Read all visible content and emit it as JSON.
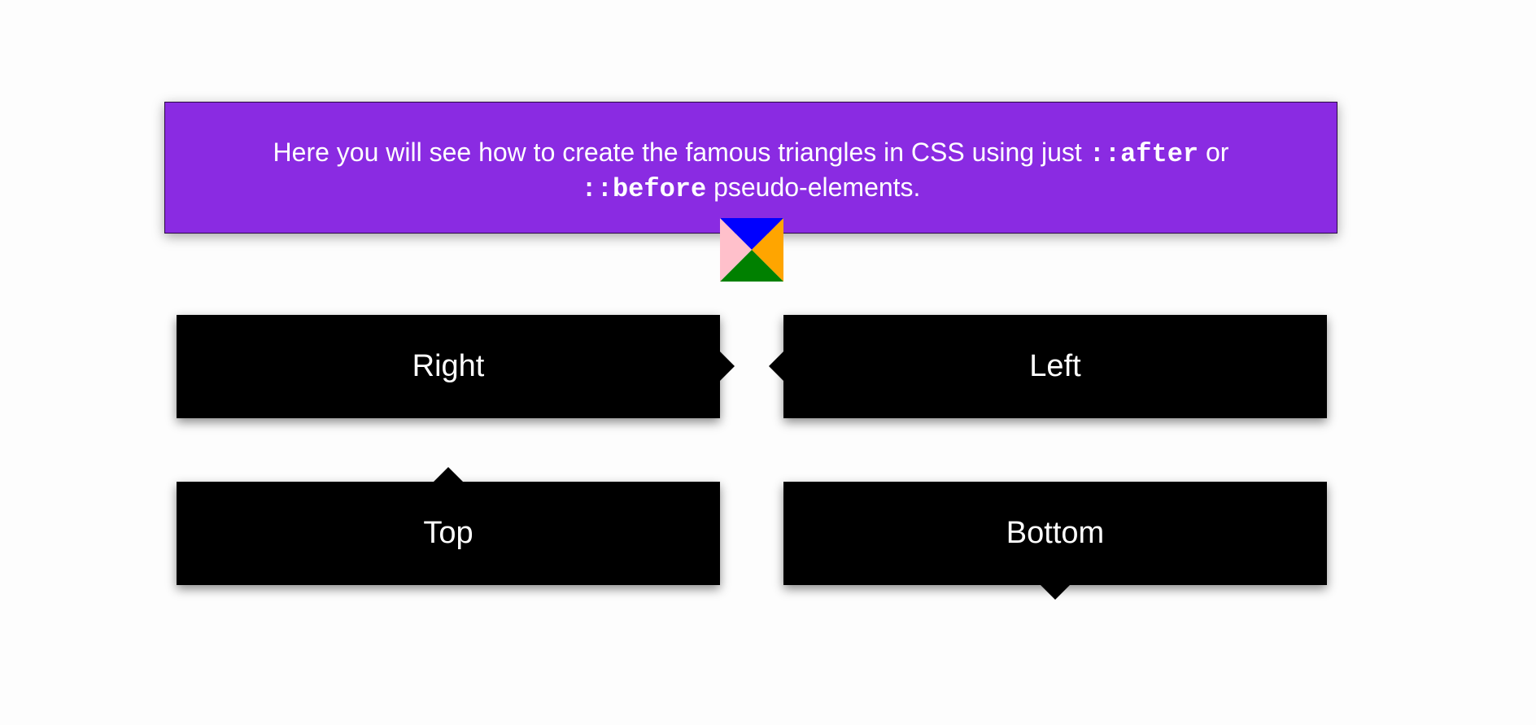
{
  "banner": {
    "text_before": "Here you will see how to create the famous triangles in CSS using just ",
    "code_after": "::after",
    "text_middle": " or ",
    "code_before": "::before",
    "text_end": " pseudo-elements."
  },
  "demo_square": {
    "colors": {
      "top": "#0000ff",
      "right": "#ffa500",
      "bottom": "#008000",
      "left": "#ffc0cb"
    }
  },
  "tooltips": {
    "right": {
      "label": "Right",
      "arrow_direction": "right"
    },
    "left": {
      "label": "Left",
      "arrow_direction": "left"
    },
    "top": {
      "label": "Top",
      "arrow_direction": "top"
    },
    "bottom": {
      "label": "Bottom",
      "arrow_direction": "bottom"
    }
  },
  "colors": {
    "banner_background": "#8a2be2",
    "tooltip_background": "#000000",
    "text": "#ffffff",
    "page_background": "#fdfdfd"
  }
}
